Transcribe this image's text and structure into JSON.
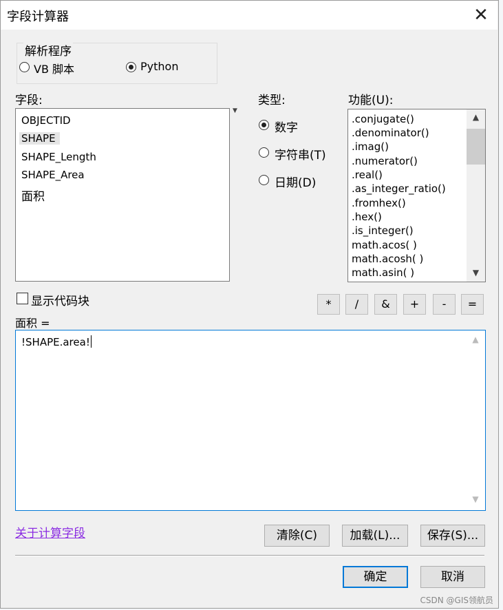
{
  "window": {
    "title": "字段计算器",
    "close_glyph": "✕"
  },
  "parser": {
    "legend": "解析程序",
    "options": [
      {
        "label": "VB 脚本",
        "selected": false
      },
      {
        "label": "Python",
        "selected": true
      }
    ]
  },
  "fields": {
    "label": "字段:",
    "items": [
      "OBJECTID",
      "SHAPE",
      "SHAPE_Length",
      "SHAPE_Area",
      "面积"
    ],
    "selected": "SHAPE"
  },
  "type": {
    "label": "类型:",
    "options": [
      {
        "label": "数字",
        "selected": true
      },
      {
        "label": "字符串(T)",
        "selected": false
      },
      {
        "label": "日期(D)",
        "selected": false
      }
    ]
  },
  "functions": {
    "label": "功能(U):",
    "items": [
      ".conjugate()",
      ".denominator()",
      ".imag()",
      ".numerator()",
      ".real()",
      ".as_integer_ratio()",
      ".fromhex()",
      ".hex()",
      ".is_integer()",
      "math.acos( )",
      "math.acosh( )",
      "math.asin( )"
    ]
  },
  "show_codeblock": {
    "label": "显示代码块",
    "checked": false
  },
  "operators": [
    "*",
    "/",
    "&",
    "+",
    "-",
    "="
  ],
  "expression": {
    "label": "面积 =",
    "value": "!SHAPE.area!"
  },
  "about_link": "关于计算字段",
  "buttons": {
    "clear": "清除(C)",
    "load": "加载(L)...",
    "save": "保存(S)...",
    "ok": "确定",
    "cancel": "取消"
  },
  "watermark": "CSDN @GIS领航员"
}
